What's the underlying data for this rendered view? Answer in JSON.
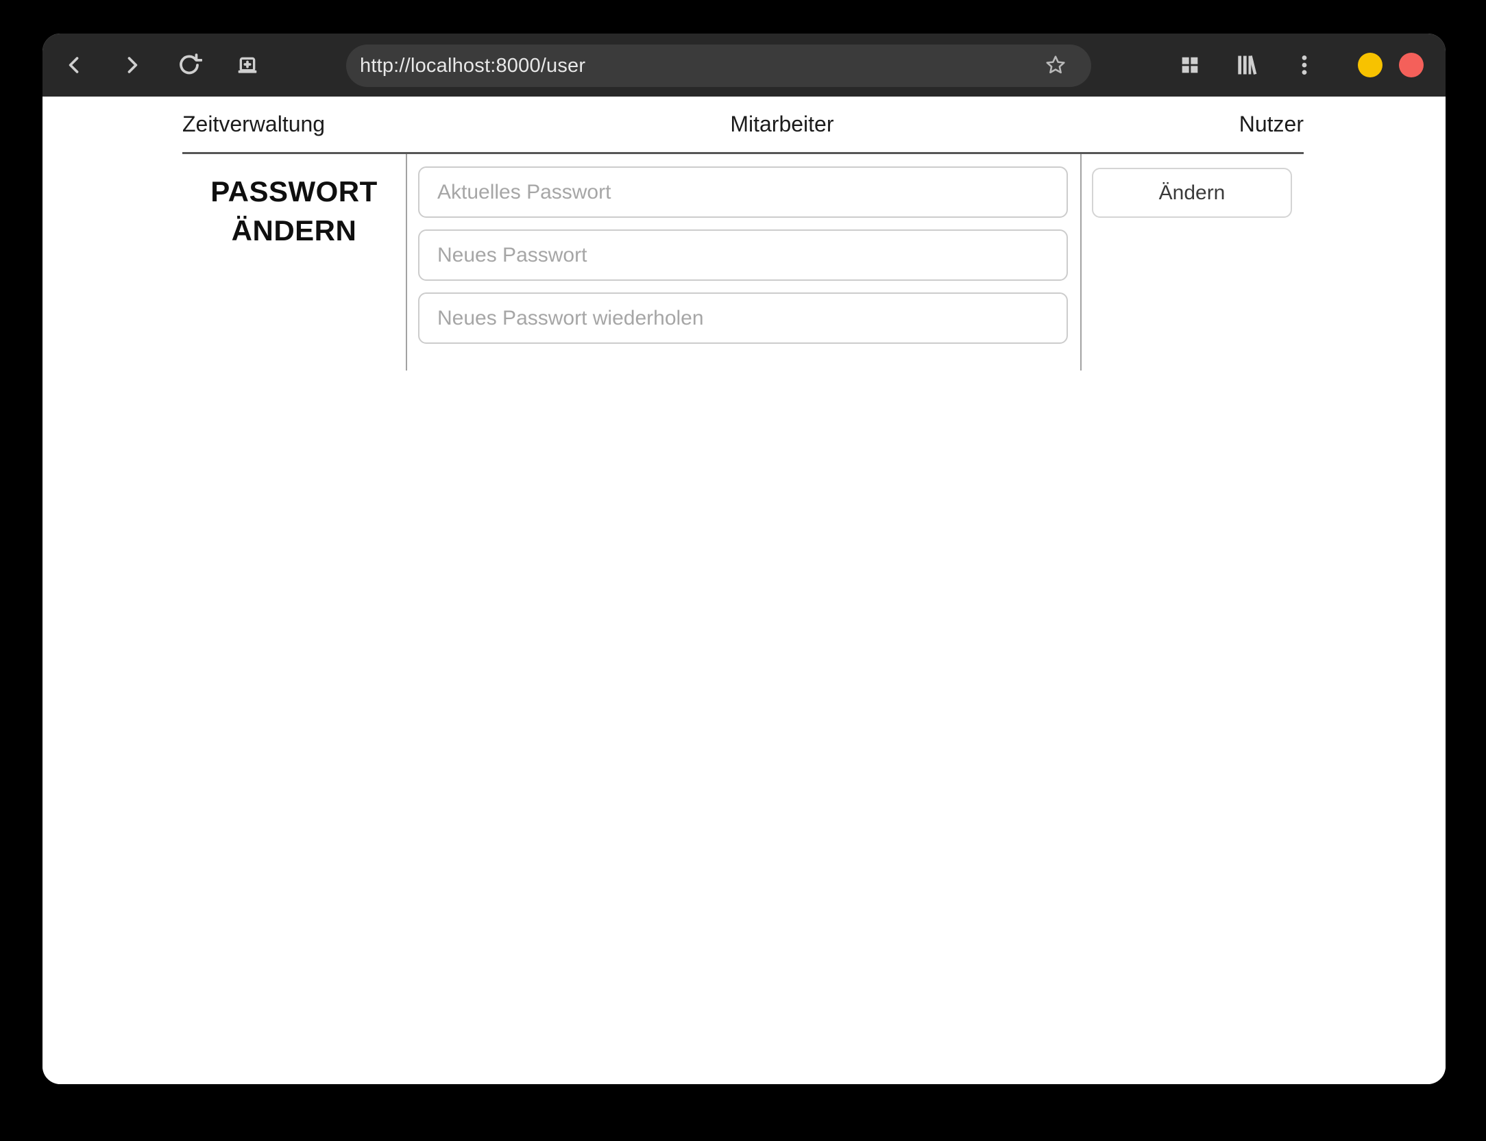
{
  "browser": {
    "url": "http://localhost:8000/user",
    "toolbar_icons": {
      "back": "back-chevron",
      "forward": "forward-chevron",
      "reload": "reload-circular-arrow",
      "new_tab": "tab-with-plus",
      "bookmark": "star-outline",
      "tab_overview": "grid-2x2",
      "library": "book-shelf",
      "menu": "kebab-three-dots"
    },
    "window_controls": {
      "minimize_color": "#f7c200",
      "close_color": "#f4605a"
    },
    "chrome_colors": {
      "toolbar_bg": "#282828",
      "urlbar_bg": "#3b3b3b",
      "icon_color": "#cfcfcf"
    }
  },
  "page": {
    "nav": {
      "items": [
        {
          "label": "Zeitverwaltung"
        },
        {
          "label": "Mitarbeiter"
        },
        {
          "label": "Nutzer"
        }
      ]
    },
    "heading": {
      "line1": "PASSWORT",
      "line2": "ÄNDERN"
    },
    "form": {
      "fields": [
        {
          "placeholder": "Aktuelles Passwort",
          "value": ""
        },
        {
          "placeholder": "Neues Passwort",
          "value": ""
        },
        {
          "placeholder": "Neues Passwort wiederholen",
          "value": ""
        }
      ],
      "submit_label": "Ändern"
    }
  }
}
